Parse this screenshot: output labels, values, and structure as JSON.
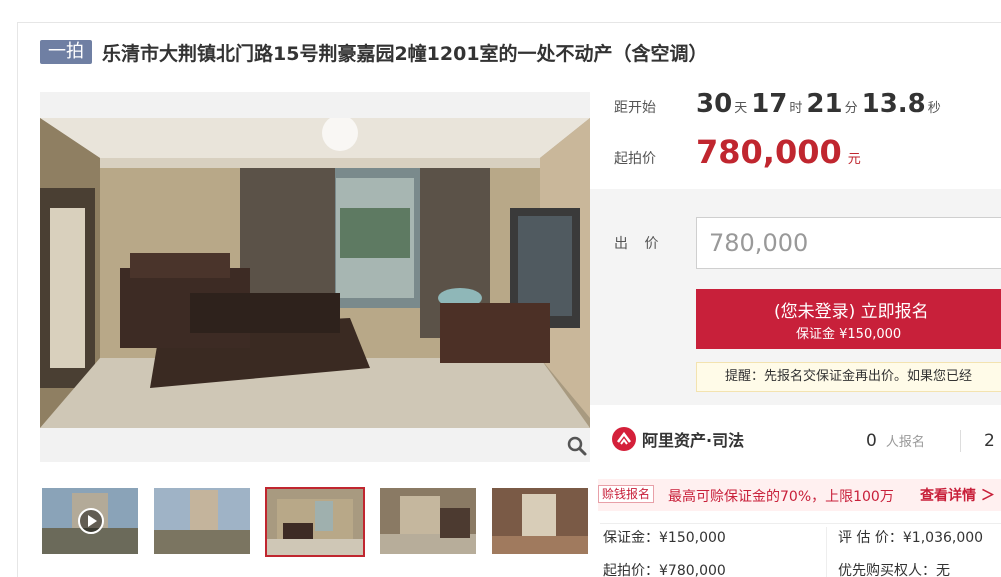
{
  "header": {
    "auction_round": "一拍",
    "title": "乐清市大荆镇北门路15号荆豪嘉园2幢1201室的一处不动产（含空调）"
  },
  "countdown": {
    "label": "距开始",
    "days": "30",
    "days_unit": "天",
    "hours": "17",
    "hours_unit": "时",
    "minutes": "21",
    "minutes_unit": "分",
    "seconds": "13.8",
    "seconds_unit": "秒"
  },
  "starting_price": {
    "label": "起拍价",
    "value": "780,000",
    "unit": "元"
  },
  "bid": {
    "label": "出 价",
    "input_value": "780,000",
    "signup_button": "(您未登录) 立即报名",
    "deposit_line": "保证金 ¥150,000",
    "tip": "提醒：先报名交保证金再出价。如果您已经"
  },
  "platform": {
    "brand": "阿里资产·司法",
    "signed_up_count": "0",
    "signed_up_label": "人报名",
    "second_count": "2"
  },
  "promo": {
    "badge": "赊钱报名",
    "text": "最高可赊保证金的70%，上限100万",
    "link": "查看详情 ＞"
  },
  "details": {
    "deposit": "保证金：¥150,000",
    "valuation": "评 估 价：¥1,036,000",
    "start_price": "起拍价：¥780,000",
    "priority_buyer": "优先购买权人",
    "priority_value": "无"
  },
  "colors": {
    "accent": "#c8203a",
    "price": "#c0262f",
    "tag": "#6f7fa3"
  },
  "icons": {
    "zoom": "magnifier-icon",
    "play": "play-icon",
    "brand": "ali-asset-logo-icon"
  }
}
